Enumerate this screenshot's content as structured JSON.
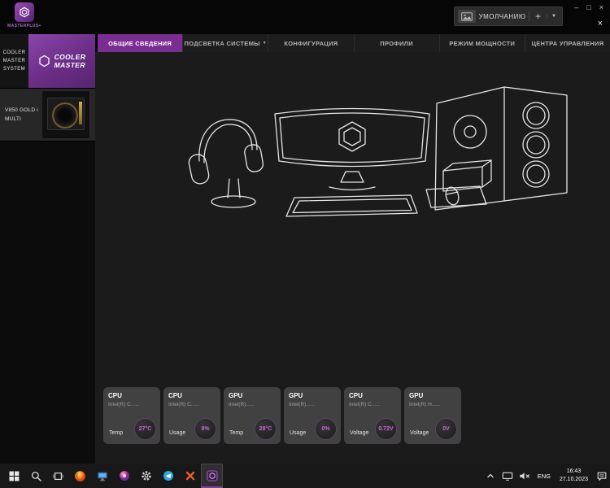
{
  "titlebar": {
    "logo_text": "MASTERPLUS+",
    "profile": {
      "value": "УМОЛЧАНИЮ",
      "add": "+",
      "caret": "▼"
    },
    "window_controls": {
      "minimize": "–",
      "maximize": "□",
      "close": "×",
      "panel_close": "×"
    }
  },
  "tabs": [
    {
      "label": "ОБЩИЕ СВЕДЕНИЯ",
      "active": true
    },
    {
      "label": "ПОДСВЕТКА СИСТЕМЫ",
      "caret": "▼"
    },
    {
      "label": "КОНФИГУРАЦИЯ"
    },
    {
      "label": "ПРОФИЛИ"
    },
    {
      "label": "РЕЖИМ МОЩНОСТИ"
    },
    {
      "label": "ЦЕНТРА УПРАВЛЕНИЯ"
    }
  ],
  "sidebar": {
    "brand_column": [
      "COOLER",
      "MASTER",
      "SYSTEM"
    ],
    "logo": {
      "line1": "COOLER",
      "line2": "MASTER"
    },
    "device": {
      "line1": "V850 GOLD i",
      "line2": "MULTI"
    }
  },
  "sensors": [
    {
      "type": "CPU",
      "device": "Intel(R) C......",
      "metric": "Temp",
      "value": "27°C"
    },
    {
      "type": "CPU",
      "device": "Intel(R) C......",
      "metric": "Usage",
      "value": "8%"
    },
    {
      "type": "GPU",
      "device": "Intel(R)......",
      "metric": "Temp",
      "value": "28°C"
    },
    {
      "type": "GPU",
      "device": "Intel(R)......",
      "metric": "Usage",
      "value": "0%"
    },
    {
      "type": "CPU",
      "device": "Intel(R) C......",
      "metric": "Voltage",
      "value": "0.72V"
    },
    {
      "type": "GPU",
      "device": "Intel(R) H......",
      "metric": "Voltage",
      "value": "0V"
    }
  ],
  "taskbar": {
    "language": "ENG",
    "time": "16:43",
    "date": "27.10.2023"
  },
  "icons": {
    "profile_image_icon": "picture-thumbnail",
    "start": "windows-logo",
    "search": "magnifier",
    "task_view": "window-frame",
    "pinned_apps": [
      "firefox",
      "display-app",
      "media-app",
      "settings-gear",
      "telegram",
      "orange-x-app",
      "masterplus"
    ],
    "tray": [
      "expand-chevron",
      "network-display",
      "volume-muted",
      "action-center"
    ]
  },
  "colors": {
    "accent_purple": "#7b2d92",
    "logo_purple": "#8a46aa",
    "badge_value_text": "#c66bd9",
    "firefox_orange": "#ff8a1e",
    "telegram_blue": "#29a9e0"
  }
}
